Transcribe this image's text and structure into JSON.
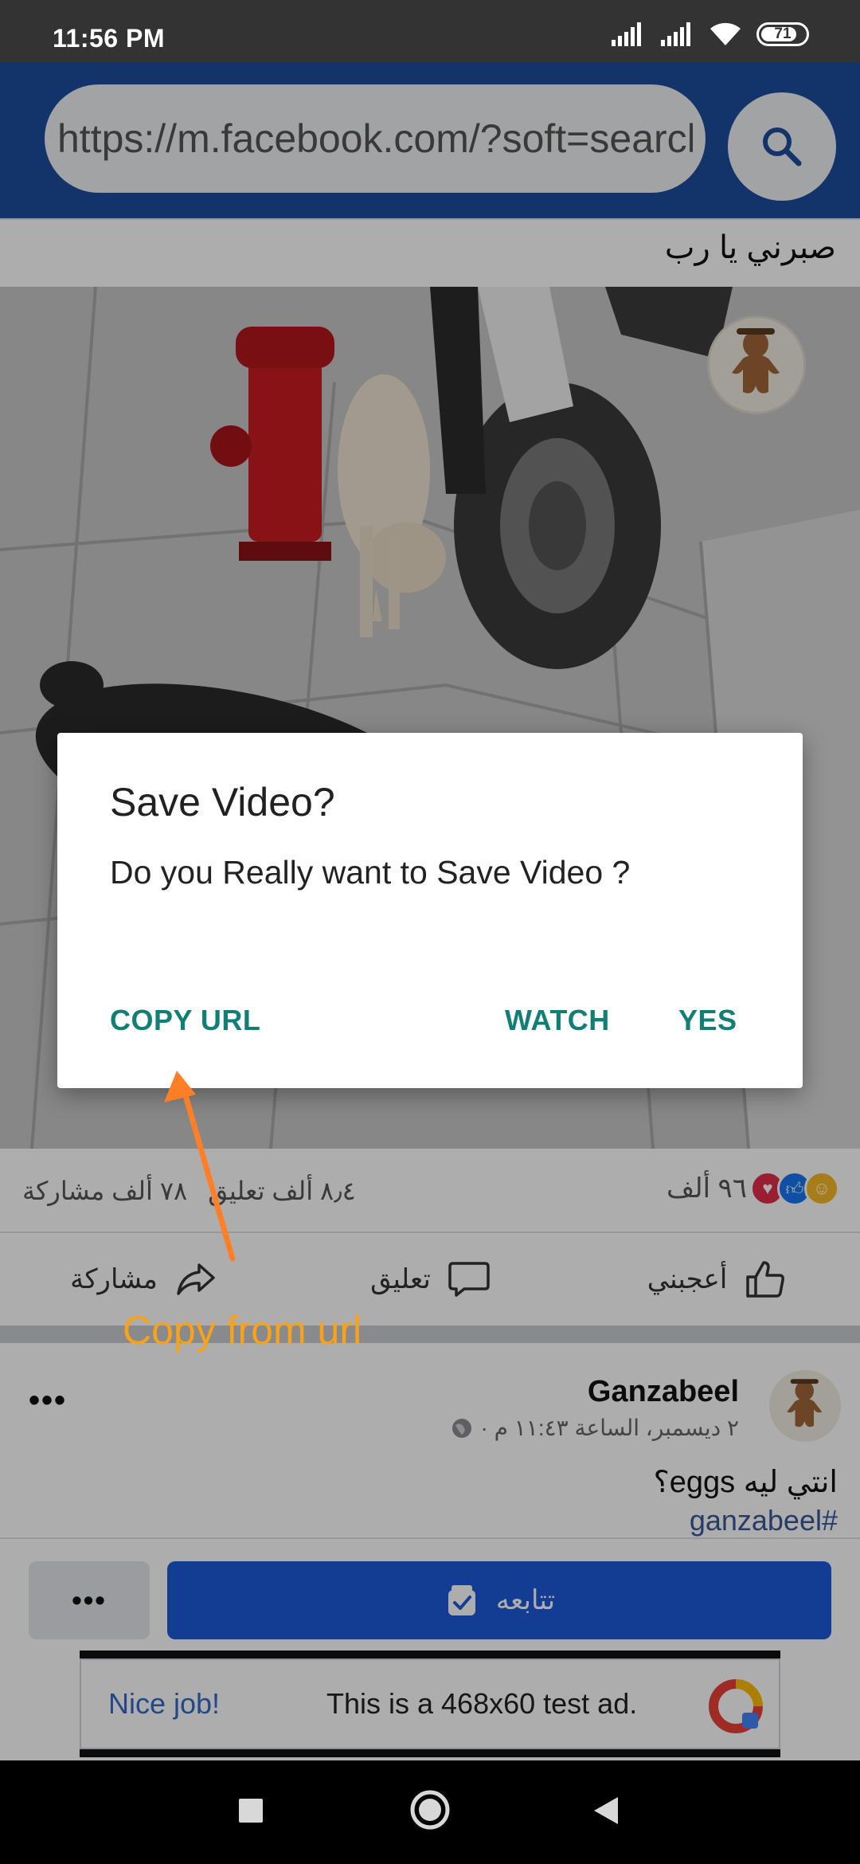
{
  "status_bar": {
    "time": "11:56 PM",
    "battery": "71"
  },
  "browser": {
    "url": "https://m.facebook.com/?soft=search"
  },
  "post": {
    "caption": "صبرني يا رب",
    "channel_badge": "جنزبيل",
    "reactions_count": "٩٦ ألف",
    "comments_count": "٨٫٤ ألف تعليق",
    "shares_count": "٧٨ ألف مشاركة",
    "actions": {
      "like": "أعجبني",
      "comment": "تعليق",
      "share": "مشاركة"
    }
  },
  "dialog": {
    "title": "Save Video?",
    "message": "Do you Really want to Save Video ?",
    "buttons": {
      "copy_url": "COPY URL",
      "watch": "WATCH",
      "yes": "YES"
    }
  },
  "annotation": {
    "text": "Copy from url",
    "color": "#f8a11a",
    "arrow_color": "#ff7f27"
  },
  "next_post": {
    "author": "Ganzabeel",
    "timestamp": "٢ ديسمبر، الساعة ١١:٤٣ م ·",
    "text": "انتي ليه eggs؟",
    "hashtag": "#ganzabeel",
    "more": "•••"
  },
  "follow_bar": {
    "more": "•••",
    "follow": "تتابعه"
  },
  "ad": {
    "headline": "Nice job!",
    "text": "This is a 468x60 test ad."
  },
  "colors": {
    "facebook_blue": "#1c4d9e",
    "dialog_accent": "#127f74",
    "follow_blue": "#1b5bd8"
  }
}
